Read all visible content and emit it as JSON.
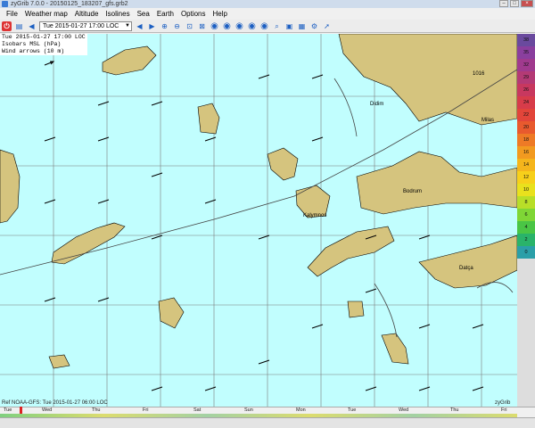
{
  "window": {
    "title": "zyGrib 7.0.0 - 20150125_183207_gfs.grb2"
  },
  "menu": [
    "File",
    "Weather map",
    "Altitude",
    "Isolines",
    "Sea",
    "Earth",
    "Options",
    "Help"
  ],
  "toolbar": {
    "date_value": "Tue 2015-01-27 17:00 LOC"
  },
  "overlay": {
    "line1": "Tue 2015-01-27 17:00 LOC",
    "line2": "Isobars MSL (hPa)",
    "line3": "Wind arrows (10 m)"
  },
  "map": {
    "isobar_label": "1016",
    "places": [
      "Didim",
      "Milas",
      "Bodrum",
      "Kalymnos",
      "Datça"
    ]
  },
  "footer": {
    "ref": "Ref NOAA-GFS: Tue 2015-01-27 06:00 LOC",
    "brand": "zyGrib"
  },
  "colorbar": [
    "38",
    "35",
    "32",
    "29",
    "26",
    "24",
    "22",
    "20",
    "18",
    "16",
    "14",
    "12",
    "10",
    "8",
    "6",
    "4",
    "2",
    "0"
  ],
  "colorbar_colors": [
    "#6a4a9e",
    "#8a3f9e",
    "#a03a8e",
    "#b43a75",
    "#c8385f",
    "#d73c4a",
    "#e2453a",
    "#e85a2e",
    "#ee7a26",
    "#f29a20",
    "#f5b51c",
    "#f7d01b",
    "#e9e11d",
    "#b8de28",
    "#7fd636",
    "#4ac545",
    "#2ab36a",
    "#2b9fa8"
  ],
  "timeline": [
    "Tue",
    "Wed",
    "Thu",
    "Fri",
    "Sat",
    "Sun",
    "Mon",
    "Tue",
    "Wed",
    "Thu",
    "Fri"
  ],
  "colors": {
    "sea": "#c1fefe",
    "land": "#d5c47e"
  }
}
